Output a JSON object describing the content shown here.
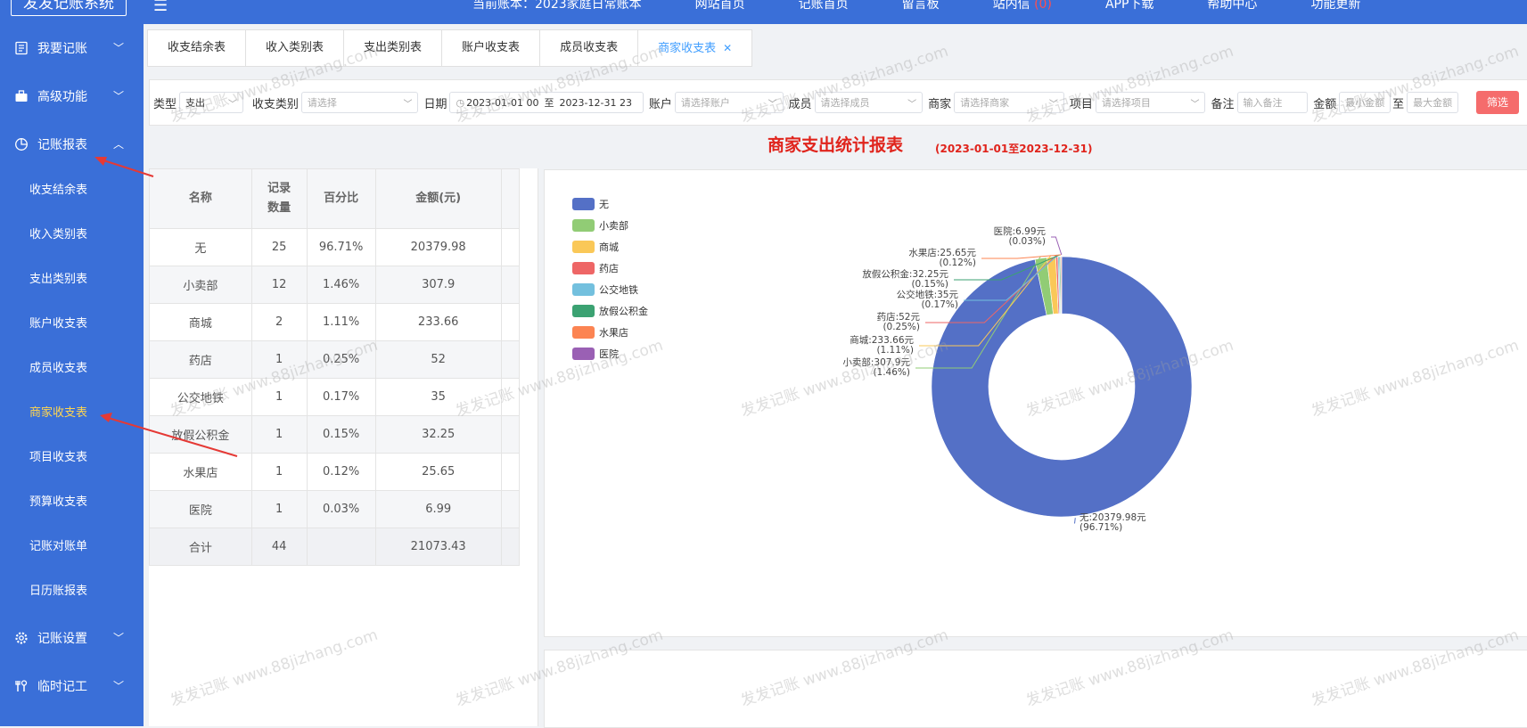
{
  "app": {
    "title": "发发记账系统"
  },
  "topbar": {
    "items": [
      {
        "label": "当前账本：2023家庭日常账本",
        "red": ""
      },
      {
        "label": "网站首页",
        "red": ""
      },
      {
        "label": "记账首页",
        "red": ""
      },
      {
        "label": "留言板",
        "red": ""
      },
      {
        "label": "站内信 ",
        "red": "(0)"
      },
      {
        "label": "APP下载",
        "red": ""
      },
      {
        "label": "帮助中心",
        "red": ""
      },
      {
        "label": "功能更新",
        "red": ""
      }
    ]
  },
  "sidebar": {
    "groups": [
      {
        "label": "我要记账",
        "icon": "book-icon"
      },
      {
        "label": "高级功能",
        "icon": "briefcase-icon"
      },
      {
        "label": "记账报表",
        "icon": "pie-chart-icon"
      }
    ],
    "items": [
      "收支结余表",
      "收入类别表",
      "支出类别表",
      "账户收支表",
      "成员收支表",
      "商家收支表",
      "项目收支表",
      "预算收支表",
      "记账对账单",
      "日历账报表"
    ],
    "active_index": 5,
    "bottom_groups": [
      {
        "label": "记账设置",
        "icon": "gear-icon"
      },
      {
        "label": "临时记工",
        "icon": "tools-icon"
      }
    ]
  },
  "tabs": [
    "收支结余表",
    "收入类别表",
    "支出类别表",
    "账户收支表",
    "成员收支表",
    "商家收支表"
  ],
  "active_tab": 5,
  "filter": {
    "type_label": "类型",
    "type_value": "支出",
    "category_label": "收支类别",
    "category_placeholder": "请选择",
    "date_label": "日期",
    "date_start": "2023-01-01 00",
    "date_sep": "至",
    "date_end": "2023-12-31 23",
    "account_label": "账户",
    "account_placeholder": "请选择账户",
    "member_label": "成员",
    "member_placeholder": "请选择成员",
    "merchant_label": "商家",
    "merchant_placeholder": "请选择商家",
    "project_label": "项目",
    "project_placeholder": "请选择项目",
    "note_label": "备注",
    "note_placeholder": "输入备注",
    "amount_label": "金额",
    "amount_min": "最小金额",
    "amount_sep": "至",
    "amount_max": "最大金额",
    "filter_button": "筛选"
  },
  "report": {
    "title": "商家支出统计报表",
    "range": "(2023-01-01至2023-12-31)"
  },
  "table": {
    "headers": [
      "名称",
      "记录\n数量",
      "百分比",
      "金额(元)"
    ],
    "rows": [
      [
        "无",
        "25",
        "96.71%",
        "20379.98"
      ],
      [
        "小卖部",
        "12",
        "1.46%",
        "307.9"
      ],
      [
        "商城",
        "2",
        "1.11%",
        "233.66"
      ],
      [
        "药店",
        "1",
        "0.25%",
        "52"
      ],
      [
        "公交地铁",
        "1",
        "0.17%",
        "35"
      ],
      [
        "放假公积金",
        "1",
        "0.15%",
        "32.25"
      ],
      [
        "水果店",
        "1",
        "0.12%",
        "25.65"
      ],
      [
        "医院",
        "1",
        "0.03%",
        "6.99"
      ]
    ],
    "total": [
      "合计",
      "44",
      "",
      "21073.43"
    ]
  },
  "chart_data": {
    "type": "pie",
    "title": "",
    "categories": [
      "无",
      "小卖部",
      "商城",
      "药店",
      "公交地铁",
      "放假公积金",
      "水果店",
      "医院"
    ],
    "values": [
      20379.98,
      307.9,
      233.66,
      52,
      35,
      32.25,
      25.65,
      6.99
    ],
    "colors": [
      "#5470c6",
      "#91cc75",
      "#fac858",
      "#ee6666",
      "#73c0de",
      "#3ba272",
      "#fc8452",
      "#9a60b4"
    ],
    "labels": [
      [
        "无:20379.98元",
        "(96.71%)"
      ],
      [
        "小卖部:307.9元",
        "(1.46%)"
      ],
      [
        "商城:233.66元",
        "(1.11%)"
      ],
      [
        "药店:52元",
        "(0.25%)"
      ],
      [
        "公交地铁:35元",
        "(0.17%)"
      ],
      [
        "放假公积金:32.25元",
        "(0.15%)"
      ],
      [
        "水果店:25.65元",
        "(0.12%)"
      ],
      [
        "医院:6.99元",
        "(0.03%)"
      ]
    ],
    "legend": "top-left"
  },
  "watermark": "发发记账 www.88jizhang.com"
}
